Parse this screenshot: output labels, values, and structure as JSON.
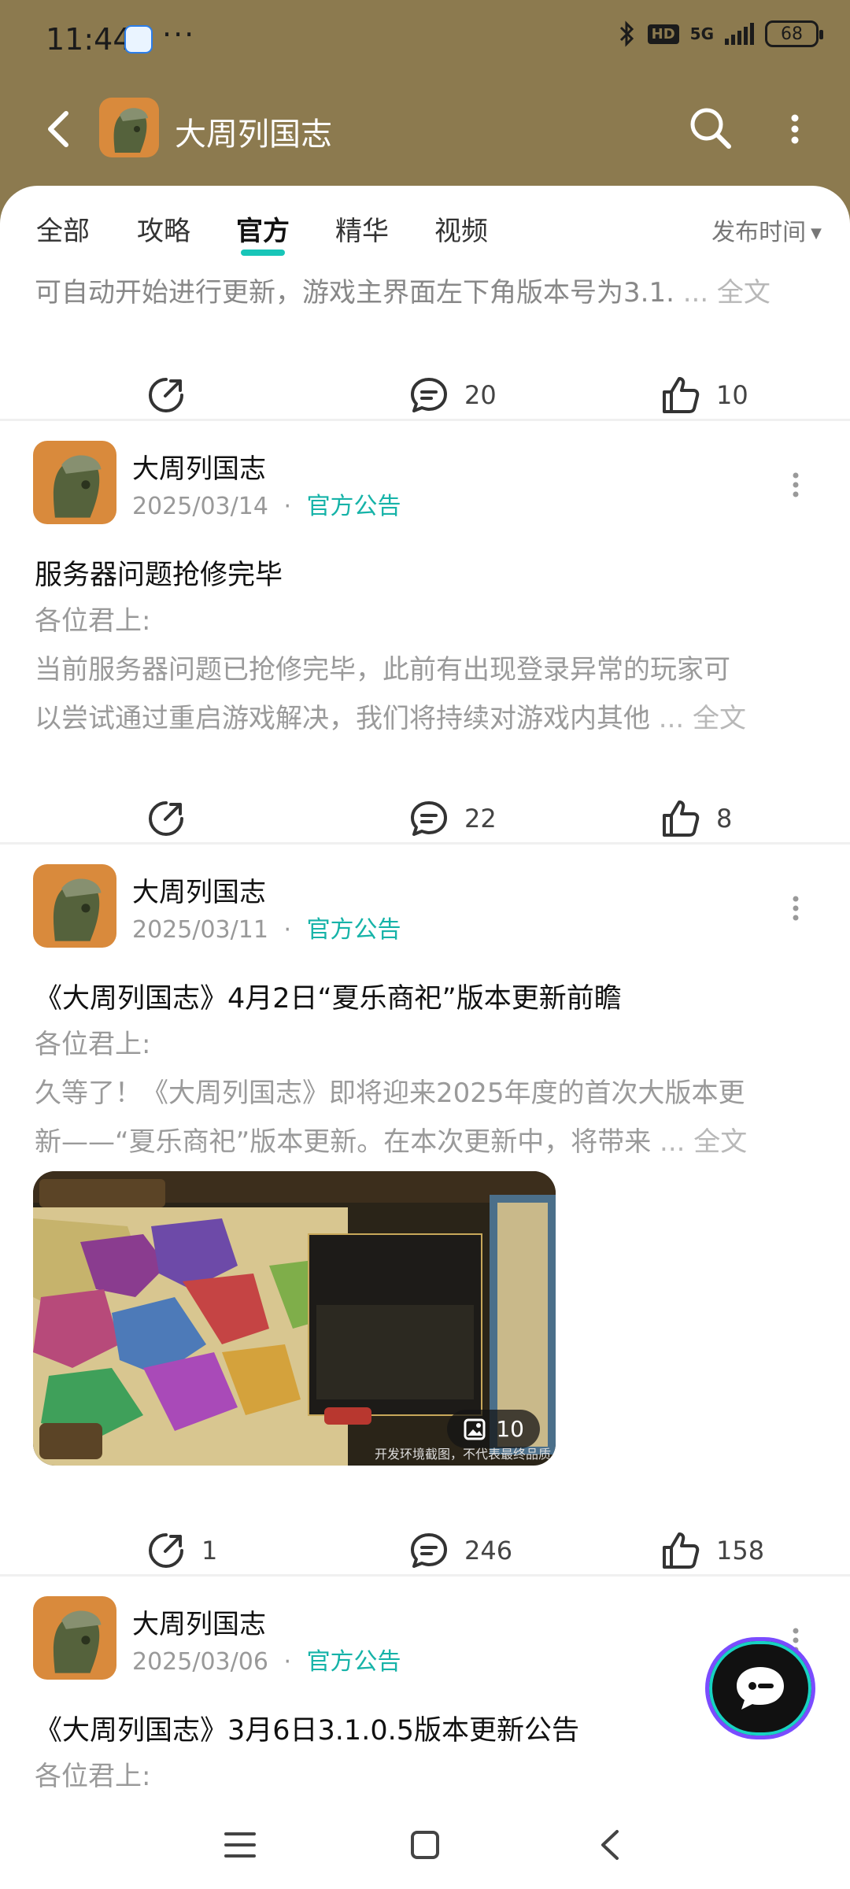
{
  "status_bar": {
    "time": "11:44",
    "more": "···",
    "network": "5G",
    "hd": "HD",
    "battery": "68"
  },
  "header": {
    "title": "大周列国志"
  },
  "tabs": [
    {
      "label": "全部",
      "active": false
    },
    {
      "label": "攻略",
      "active": false
    },
    {
      "label": "官方",
      "active": true
    },
    {
      "label": "精华",
      "active": false
    },
    {
      "label": "视频",
      "active": false
    }
  ],
  "sort_label": "发布时间",
  "truncated_post": {
    "text": "可自动开始进行更新，游戏主界面左下角版本号为3.1.",
    "more": " ... 全文",
    "shares": "",
    "comments": "20",
    "likes": "10"
  },
  "posts": [
    {
      "author": "大周列国志",
      "date": "2025/03/14",
      "separator": "·",
      "tag": "官方公告",
      "title": "服务器问题抢修完毕",
      "lines": [
        "各位君上:",
        "当前服务器问题已抢修完毕，此前有出现登录异常的玩家可",
        "以尝试通过重启游戏解决，我们将持续对游戏内其他"
      ],
      "more": " ... 全文",
      "shares": "",
      "comments": "22",
      "likes": "8"
    },
    {
      "author": "大周列国志",
      "date": "2025/03/11",
      "separator": "·",
      "tag": "官方公告",
      "title": "《大周列国志》4月2日“夏乐商祀”版本更新前瞻",
      "lines": [
        "各位君上:",
        "久等了！《大周列国志》即将迎来2025年度的首次大版本更",
        "新——“夏乐商祀”版本更新。在本次更新中，将带来"
      ],
      "more": " ... 全文",
      "image_count": "10",
      "image_caption": "开发环境截图，不代表最终品质",
      "shares": "1",
      "comments": "246",
      "likes": "158"
    },
    {
      "author": "大周列国志",
      "date": "2025/03/06",
      "separator": "·",
      "tag": "官方公告",
      "title": "《大周列国志》3月6日3.1.0.5版本更新公告",
      "lines": [
        "各位君上:"
      ]
    }
  ],
  "colors": {
    "header_bg": "#8c7a4f",
    "accent": "#16b3a8",
    "tab_underline": "#18c5b8"
  }
}
